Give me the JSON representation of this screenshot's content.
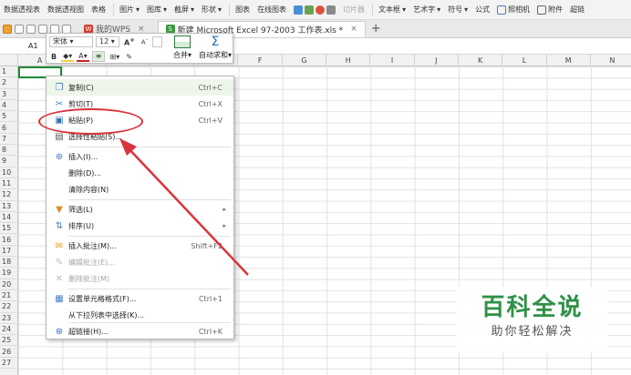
{
  "ribbon": {
    "items": [
      {
        "label": "数据透视表",
        "dropdown": false
      },
      {
        "label": "数据透视图",
        "dropdown": false
      },
      {
        "label": "表格",
        "dropdown": false
      },
      {
        "label": "图片",
        "dropdown": true
      },
      {
        "label": "图库",
        "dropdown": true
      },
      {
        "label": "截屏",
        "dropdown": true
      },
      {
        "label": "形状",
        "dropdown": true
      },
      {
        "label": "图表",
        "dropdown": false
      },
      {
        "label": "在线图表",
        "dropdown": false
      },
      {
        "label": "切片器",
        "dropdown": false,
        "disabled": true
      },
      {
        "label": "文本框",
        "dropdown": true
      },
      {
        "label": "艺术字",
        "dropdown": true
      },
      {
        "label": "符号",
        "dropdown": true
      },
      {
        "label": "公式",
        "dropdown": false
      },
      {
        "label": "照相机",
        "dropdown": false
      },
      {
        "label": "附件",
        "dropdown": false
      },
      {
        "label": "超链",
        "dropdown": false
      }
    ]
  },
  "tabs": [
    {
      "label": "我的WPS",
      "close": "×",
      "badge": "W"
    },
    {
      "label": "新建 Microsoft Excel 97-2003 工作表.xls *",
      "close": "×",
      "badge": "S",
      "active": true
    }
  ],
  "tab_add": "+",
  "namebox": "A1",
  "minitoolbar": {
    "font": "宋体",
    "size": "12",
    "grow": "A",
    "shrink": "A",
    "bold": "B",
    "merge_label": "合并",
    "autosum_label": "自动求和",
    "autosum_symbol": "Σ"
  },
  "columns": [
    "A",
    "B",
    "C",
    "D",
    "E",
    "F",
    "G",
    "H",
    "I",
    "J",
    "K",
    "L",
    "M",
    "N"
  ],
  "rows": [
    "1",
    "2",
    "3",
    "4",
    "5",
    "6",
    "7",
    "8",
    "9",
    "10",
    "11",
    "12",
    "13",
    "14",
    "15",
    "16",
    "17",
    "18",
    "19",
    "20",
    "21",
    "22",
    "23",
    "24",
    "25",
    "26",
    "27"
  ],
  "context_menu": {
    "items": [
      {
        "label": "复制(C)",
        "shortcut": "Ctrl+C",
        "icon": "copy-icon",
        "state": "hover"
      },
      {
        "label": "剪切(T)",
        "shortcut": "Ctrl+X",
        "icon": "scissors-icon"
      },
      {
        "label": "粘贴(P)",
        "shortcut": "Ctrl+V",
        "icon": "paste-icon"
      },
      {
        "label": "选择性粘贴(S)...",
        "shortcut": "",
        "icon": "paste-special-icon"
      },
      {
        "label": "插入(I)...",
        "shortcut": "",
        "icon": "insert-icon"
      },
      {
        "label": "删除(D)...",
        "shortcut": "",
        "icon": ""
      },
      {
        "label": "清除内容(N)",
        "shortcut": "",
        "icon": ""
      },
      {
        "label": "筛选(L)",
        "shortcut": "",
        "icon": "filter-icon",
        "submenu": true
      },
      {
        "label": "排序(U)",
        "shortcut": "",
        "icon": "sort-icon",
        "submenu": true
      },
      {
        "label": "插入批注(M)...",
        "shortcut": "Shift+F2",
        "icon": "comment-icon"
      },
      {
        "label": "编辑批注(E)...",
        "shortcut": "",
        "icon": "edit-comment-icon",
        "disabled": true
      },
      {
        "label": "删除批注(M)",
        "shortcut": "",
        "icon": "delete-comment-icon",
        "disabled": true
      },
      {
        "label": "设置单元格格式(F)...",
        "shortcut": "Ctrl+1",
        "icon": "format-cells-icon"
      },
      {
        "label": "从下拉列表中选择(K)...",
        "shortcut": "",
        "icon": ""
      },
      {
        "label": "超链接(H)...",
        "shortcut": "Ctrl+K",
        "icon": "hyperlink-icon"
      }
    ]
  },
  "watermark": {
    "title": "百科全说",
    "subtitle": "助你轻松解决"
  },
  "colors": {
    "selection": "#1e8b3a",
    "annotation": "#d9333b",
    "watermark_green": "#2f9146"
  }
}
